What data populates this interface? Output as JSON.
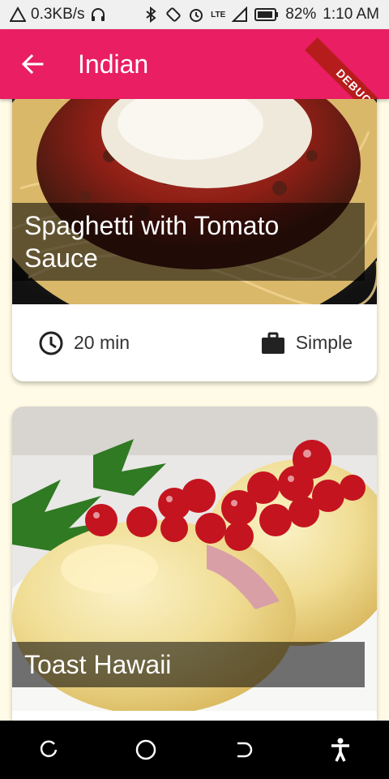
{
  "status_bar": {
    "data_speed": "0.3KB/s",
    "network_label": "LTE",
    "battery": "82%",
    "time": "1:10 AM"
  },
  "app_bar": {
    "title": "Indian",
    "back_icon": "arrow-back-icon",
    "color": "#e91e63"
  },
  "debug_banner": "DEBUG",
  "meals": [
    {
      "title": "Spaghetti with Tomato Sauce",
      "duration": "20 min",
      "complexity": "Simple",
      "image": "spaghetti-photo"
    },
    {
      "title": "Toast Hawaii",
      "image": "toast-hawaii-photo"
    }
  ],
  "nav_bar": {
    "items": [
      "recents-icon",
      "home-icon",
      "back-icon",
      "accessibility-icon"
    ]
  }
}
